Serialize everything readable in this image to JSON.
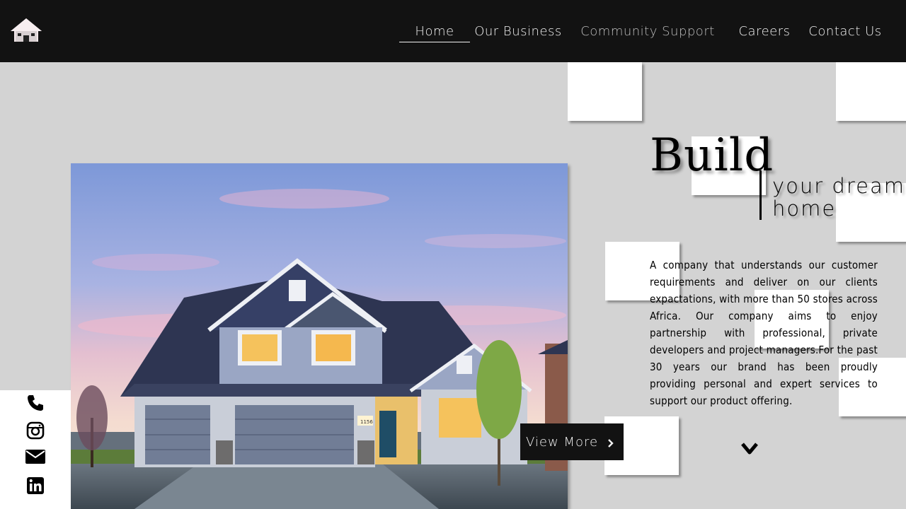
{
  "nav": {
    "items": [
      {
        "label": "Home"
      },
      {
        "label": "Our Business"
      },
      {
        "label": "Community Support"
      },
      {
        "label": "Careers"
      },
      {
        "label": "Contact Us"
      }
    ]
  },
  "hero": {
    "title": "Build",
    "subtitle_line1": "your dream",
    "subtitle_line2": "home",
    "description": "A company that understands our customer requirements and deliver on our clients expactations, with more than 50 stores across Africa. Our company aims to enjoy partnership with professional, private developers and project managers.For the past 30 years our brand has been proudly providing personal and expert services to support our product offering.",
    "cta_label": "View More",
    "house_number": "1156"
  },
  "social": {
    "icons": [
      "phone-icon",
      "instagram-icon",
      "mail-icon",
      "linkedin-icon"
    ]
  },
  "colors": {
    "navbar": "#121212",
    "background": "#d3d3d3",
    "accent": "#ffffff",
    "text": "#000000"
  }
}
